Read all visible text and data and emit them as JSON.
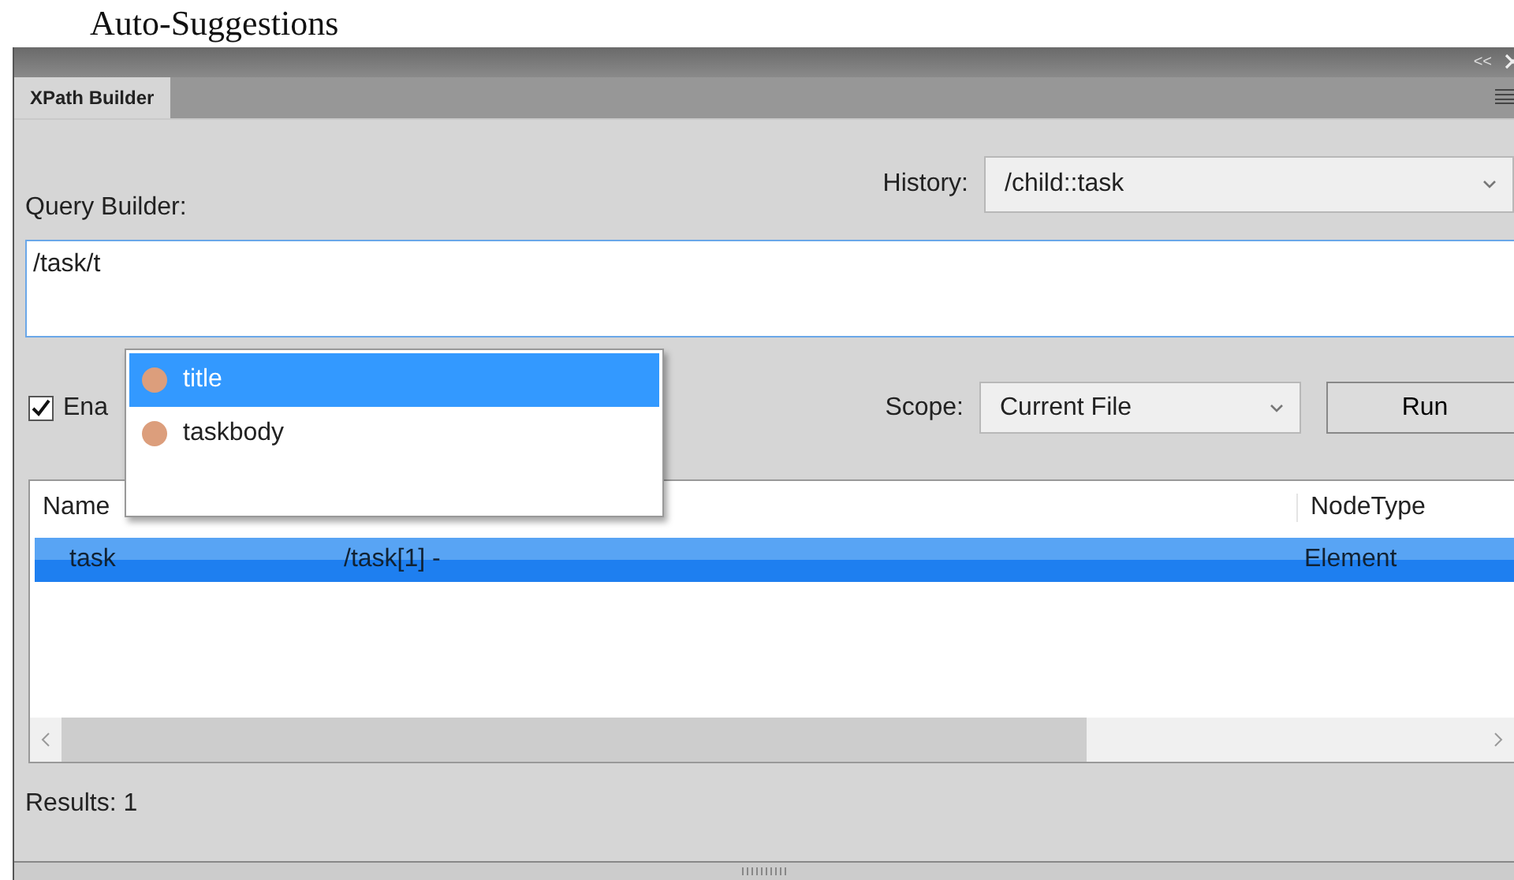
{
  "heading": "Auto-Suggestions",
  "panel": {
    "collapse_label": "<<",
    "tabs": [
      {
        "label": "XPath Builder",
        "selected": true
      }
    ]
  },
  "query_label": "Query Builder:",
  "history": {
    "label": "History:",
    "value": "/child::task"
  },
  "query": {
    "value": "/task/t"
  },
  "suggestions": [
    {
      "label": "title",
      "selected": true
    },
    {
      "label": "taskbody",
      "selected": false
    }
  ],
  "enable": {
    "label": "Ena",
    "checked": true
  },
  "scope": {
    "label": "Scope:",
    "value": "Current File"
  },
  "run_button": "Run",
  "table": {
    "columns": {
      "name": "Name",
      "node_type": "NodeType"
    },
    "rows": [
      {
        "name": "task",
        "description": "/task[1] -",
        "node_type": "Element",
        "selected": true
      }
    ]
  },
  "results": "Results: 1"
}
